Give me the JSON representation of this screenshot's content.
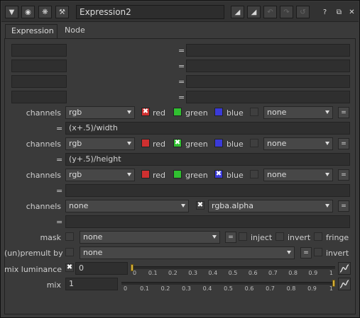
{
  "window": {
    "name_value": "Expression2"
  },
  "titlebar_icons": [
    "collapse-icon",
    "viewer-icon",
    "bug-icon",
    "wrench-icon",
    "color-swatch-icon",
    "color-swatch-2-icon",
    "undo-icon",
    "redo-icon",
    "reset-icon",
    "help-icon",
    "float-icon",
    "close-icon"
  ],
  "titlebar_labels": {
    "help": "?",
    "float": "⧉",
    "close": "✕"
  },
  "tabs": [
    {
      "label": "Expression",
      "active": true
    },
    {
      "label": "Node",
      "active": false
    }
  ],
  "temp_rows": [
    {
      "name": "",
      "eq": "=",
      "expr": ""
    },
    {
      "name": "",
      "eq": "=",
      "expr": ""
    },
    {
      "name": "",
      "eq": "=",
      "expr": ""
    },
    {
      "name": "",
      "eq": "=",
      "expr": ""
    }
  ],
  "channel_rows": [
    {
      "label": "channels",
      "channel": "rgb",
      "red_label": "red",
      "green_label": "green",
      "blue_label": "blue",
      "red_on": false,
      "green_on": true,
      "blue_on": true,
      "extra": "none",
      "eq_btn": "=",
      "expr_eq": "=",
      "expr": "(x+.5)/width"
    },
    {
      "label": "channels",
      "channel": "rgb",
      "red_label": "red",
      "green_label": "green",
      "blue_label": "blue",
      "red_on": true,
      "green_on": false,
      "blue_on": true,
      "extra": "none",
      "eq_btn": "=",
      "expr_eq": "=",
      "expr": "(y+.5)/height"
    },
    {
      "label": "channels",
      "channel": "rgb",
      "red_label": "red",
      "green_label": "green",
      "blue_label": "blue",
      "red_on": true,
      "green_on": true,
      "blue_on": false,
      "extra": "none",
      "eq_btn": "=",
      "expr_eq": "=",
      "expr": ""
    }
  ],
  "channel_row4": {
    "label": "channels",
    "channel": "none",
    "alpha": "rgba.alpha",
    "eq_btn": "=",
    "expr_eq": "=",
    "expr": ""
  },
  "mask": {
    "label": "mask",
    "value": "none",
    "eq_btn": "=",
    "inject": "inject",
    "invert": "invert",
    "fringe": "fringe"
  },
  "premult": {
    "label": "(un)premult by",
    "value": "none",
    "eq_btn": "=",
    "invert": "invert"
  },
  "mix_luminance": {
    "label": "mix luminance",
    "value": "0",
    "fraction": 0
  },
  "mix": {
    "label": "mix",
    "value": "1",
    "fraction": 1
  },
  "slider_ticks": [
    "0",
    "0.1",
    "0.2",
    "0.3",
    "0.4",
    "0.5",
    "0.6",
    "0.7",
    "0.8",
    "0.9",
    "1"
  ],
  "colors": {
    "red": "#d03030",
    "green": "#30c030",
    "blue": "#3a3ad8",
    "handle": "#d6b13a"
  }
}
